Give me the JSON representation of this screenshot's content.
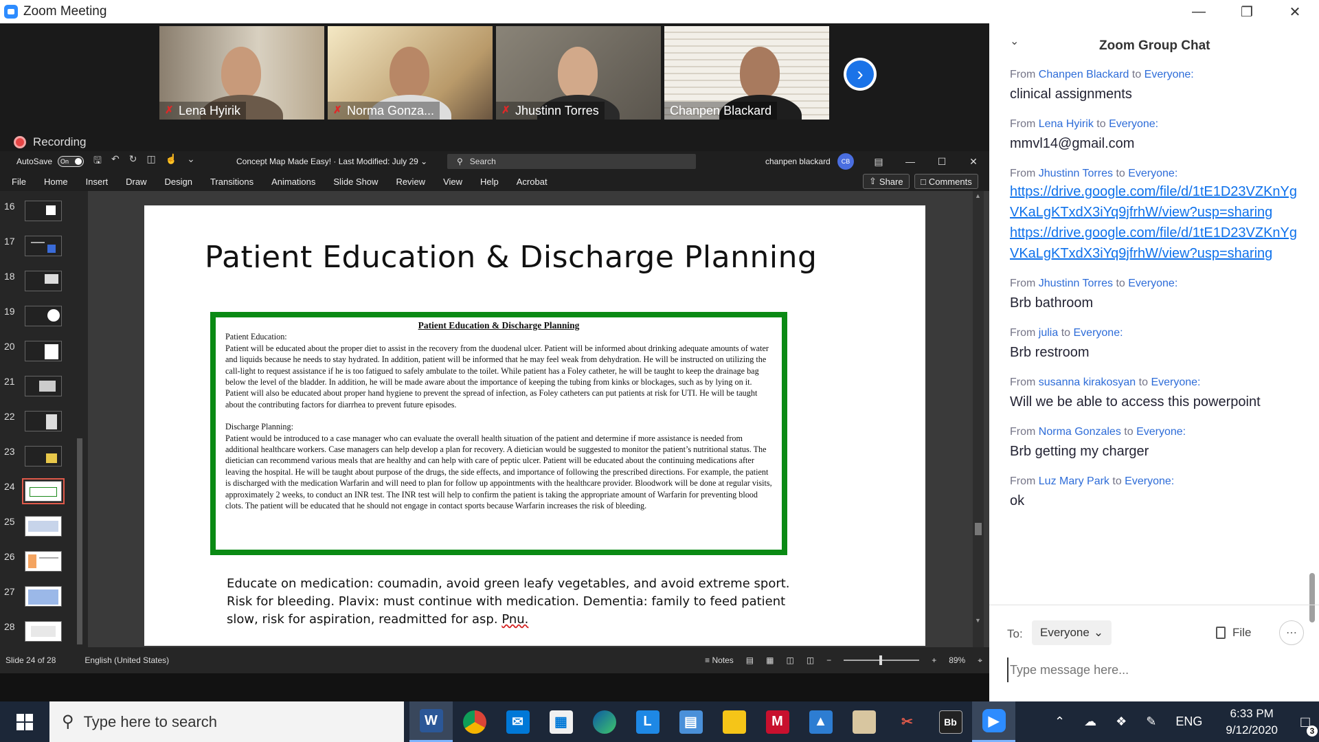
{
  "zoom": {
    "window_title": "Zoom Meeting",
    "recording_label": "Recording",
    "participants": [
      {
        "name": "Lena Hyirik",
        "muted": true
      },
      {
        "name": "Norma Gonza...",
        "muted": true
      },
      {
        "name": "Jhustinn Torres",
        "muted": true
      },
      {
        "name": "Chanpen Blackard",
        "muted": false,
        "active": true
      }
    ]
  },
  "ppt": {
    "autosave_label": "AutoSave",
    "autosave_state": "On",
    "doc_title": "Concept Map Made Easy! · Last Modified: July 29 ⌄",
    "search_placeholder": "Search",
    "user_name": "chanpen blackard",
    "user_initials": "CB",
    "menu_tabs": [
      "File",
      "Home",
      "Insert",
      "Draw",
      "Design",
      "Transitions",
      "Animations",
      "Slide Show",
      "Review",
      "View",
      "Help",
      "Acrobat"
    ],
    "share_label": "Share",
    "comments_label": "Comments",
    "slide_numbers": [
      "16",
      "17",
      "18",
      "19",
      "20",
      "21",
      "22",
      "23",
      "24",
      "25",
      "26",
      "27",
      "28"
    ],
    "selected_slide": "24",
    "slide": {
      "title": "Patient Education & Discharge Planning",
      "doc_heading": "Patient Education & Discharge Planning",
      "edu_label": "Patient Education:",
      "edu_text": "Patient will be educated about the proper diet to assist in the recovery from the duodenal ulcer.  Patient will be informed about drinking adequate amounts of water and liquids because he needs to stay hydrated.  In addition, patient will be informed that he may feel weak from dehydration.  He will be instructed on utilizing the call-light to request assistance if he is too fatigued to safely ambulate to the toilet.  While patient has a Foley catheter, he will be taught to keep the drainage bag below the level of the bladder.  In addition, he will be made aware about the importance of keeping the tubing from kinks or blockages, such as by lying on it.  Patient will also be educated about proper hand hygiene to prevent the spread of infection, as Foley catheters can put patients at risk for UTI. He will be taught about the contributing factors for diarrhea to prevent future episodes.",
      "discharge_label": "Discharge Planning:",
      "discharge_text": "Patient would be introduced to a case manager who can evaluate the overall health situation of the patient and determine if more assistance is needed from additional healthcare workers.  Case managers can help develop a plan for recovery.  A dietician would be suggested to monitor the patient’s nutritional status.  The dietician can recommend various meals that are healthy and can help with care of peptic ulcer.  Patient will be educated about the continuing medications after leaving the hospital.  He will be taught about purpose of the drugs, the side effects, and importance of following the prescribed directions.  For example, the patient is discharged with the medication Warfarin and will need to plan for follow up appointments with the healthcare provider.  Bloodwork will be done at regular visits, approximately 2 weeks, to conduct an INR test.  The INR test will help to confirm the patient is taking the appropriate amount of Warfarin for preventing blood clots. The patient will be educated that he should not engage in contact sports because Warfarin increases the risk of bleeding.",
      "notes_line1": "Educate on medication: coumadin, avoid green leafy vegetables, and avoid extreme sport.",
      "notes_line2": "Risk for bleeding. Plavix: must continue with medication. Dementia: family to feed patient",
      "notes_line3_a": "slow, risk for aspiration, readmitted for asp. ",
      "notes_line3_b": "Pnu."
    },
    "status": {
      "slide_info": "Slide 24 of 28",
      "language": "English (United States)",
      "notes_label": "Notes",
      "zoom_level": "89%"
    }
  },
  "chat": {
    "title": "Zoom Group Chat",
    "from_word": "From",
    "to_word": "to",
    "everyone": "Everyone:",
    "messages": [
      {
        "sender": "Chanpen Blackard",
        "text": "clinical assignments"
      },
      {
        "sender": "Lena Hyirik",
        "text": "mmvl14@gmail.com"
      },
      {
        "sender": "Jhustinn Torres",
        "link1": "https://drive.google.com/file/d/1tE1D23VZKnYgVKaLgKTxdX3iYq9jfrhW/view?usp=sharing",
        "link2": "https://drive.google.com/file/d/1tE1D23VZKnYgVKaLgKTxdX3iYq9jfrhW/view?usp=sharing"
      },
      {
        "sender": "Jhustinn Torres",
        "text": "Brb bathroom"
      },
      {
        "sender": "julia",
        "text": "Brb restroom"
      },
      {
        "sender": "susanna kirakosyan",
        "text": "Will we be able to access this powerpoint"
      },
      {
        "sender": "Norma Gonzales",
        "text": "Brb getting my charger"
      },
      {
        "sender": "Luz Mary Park",
        "text": "ok"
      }
    ],
    "to_label": "To:",
    "recipient": "Everyone",
    "file_label": "File",
    "input_placeholder": "Type message here..."
  },
  "taskbar": {
    "search_placeholder": "Type here to search",
    "language": "ENG",
    "time": "6:33 PM",
    "date": "9/12/2020",
    "notification_count": "3"
  }
}
